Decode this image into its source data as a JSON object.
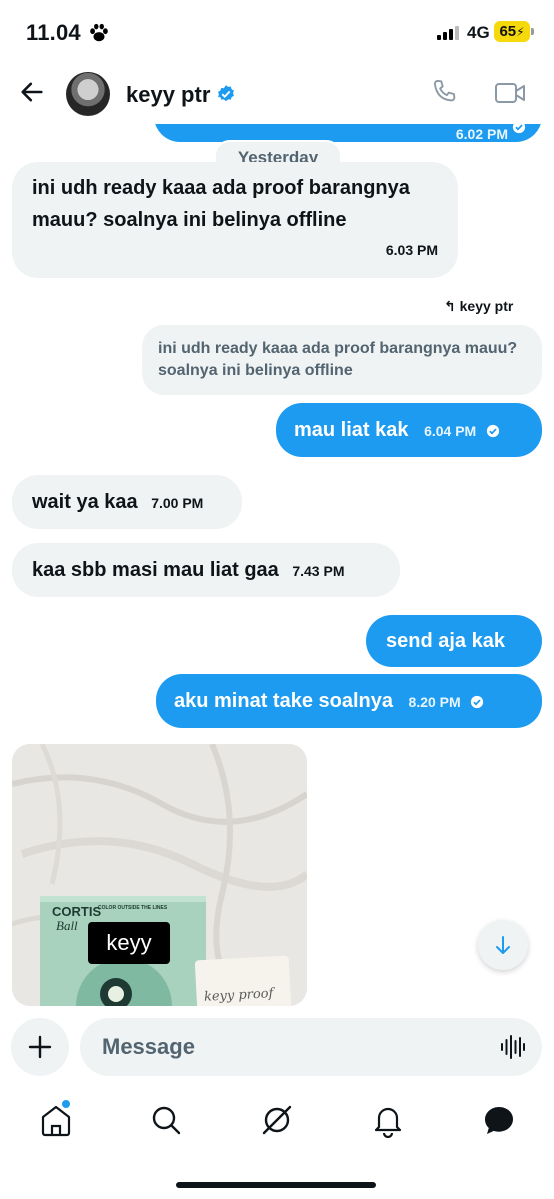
{
  "status_bar": {
    "time": "11.04",
    "network": "4G",
    "battery": "65"
  },
  "header": {
    "contact_name": "keyy ptr"
  },
  "colors": {
    "accent": "#1d9bf0",
    "incoming_bg": "#eff3f4",
    "battery": "#f5d90a"
  },
  "icons": [
    "back-arrow-icon",
    "verified-badge-icon",
    "phone-icon",
    "video-icon",
    "plus-icon",
    "voice-icon",
    "home-icon",
    "search-icon",
    "grok-icon",
    "bell-icon",
    "messages-icon"
  ],
  "conversation": {
    "top_partial_time": "6.02 PM",
    "day_divider": "Yesterday",
    "messages": [
      {
        "dir": "in",
        "text": "ini udh ready kaaa ada proof barangnya mauu? soalnya ini belinya offline",
        "time": "6.03 PM"
      },
      {
        "dir": "out",
        "reply_to_label": "keyy ptr",
        "quoted_text": "ini udh ready kaaa ada proof barangnya mauu? soalnya ini belinya offline",
        "text": "mau liat kak",
        "time": "6.04 PM"
      },
      {
        "dir": "in",
        "text": "wait ya kaa",
        "time": "7.00 PM"
      },
      {
        "dir": "in",
        "text": "kaa sbb masi mau liat gaa",
        "time": "7.43 PM"
      },
      {
        "dir": "out",
        "text": "send aja kak",
        "time": ""
      },
      {
        "dir": "out",
        "text": "aku minat take soalnya",
        "time": "8.20 PM"
      }
    ],
    "image": {
      "box_brand": "CORTIS",
      "box_sub": "Ball",
      "box_tagline": "COLOR OUTSIDE THE LINES",
      "sticker_text": "keyy",
      "note_text": "keyy proof"
    }
  },
  "composer": {
    "placeholder": "Message"
  }
}
